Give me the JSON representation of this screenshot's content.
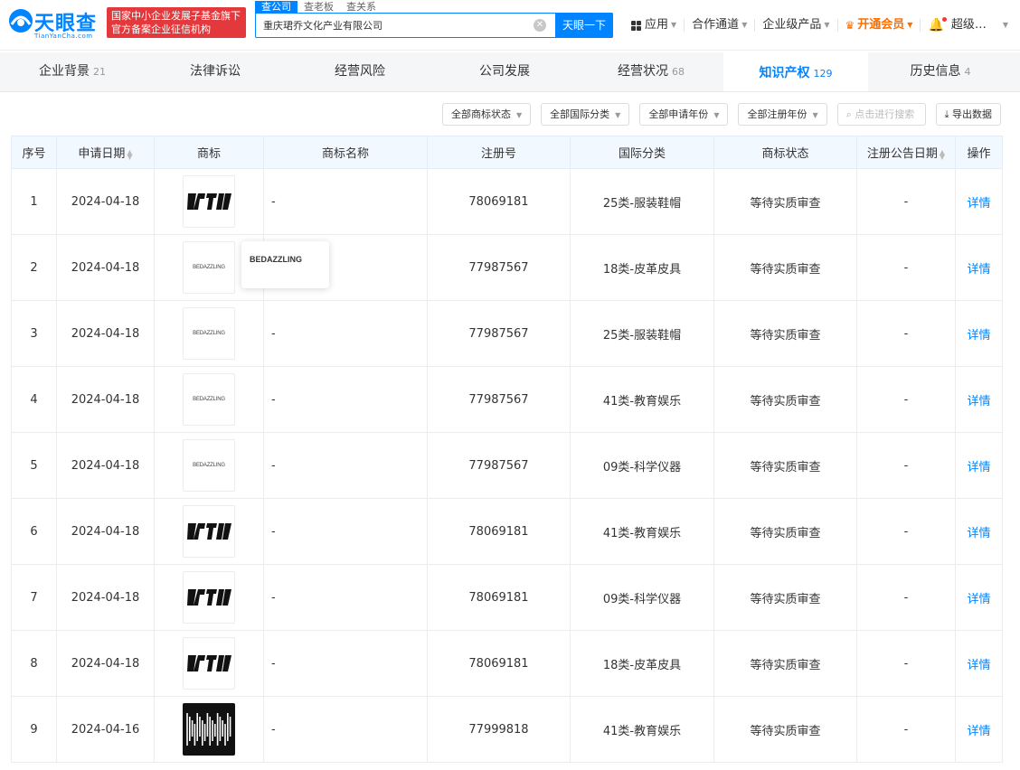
{
  "header": {
    "logo_cn": "天眼查",
    "logo_en": "TianYanCha.com",
    "badge_line1": "国家中小企业发展子基金旗下",
    "badge_line2": "官方备案企业征信机构",
    "search_tabs": [
      "查公司",
      "查老板",
      "查关系"
    ],
    "search_value": "重庆珺乔文化产业有限公司",
    "search_button": "天眼一下",
    "nav": {
      "app": "应用",
      "partner": "合作通道",
      "enterprise": "企业级产品",
      "vip": "开通会员",
      "user": "超级…"
    }
  },
  "tabs": [
    {
      "label": "企业背景",
      "count": "21"
    },
    {
      "label": "法律诉讼",
      "count": ""
    },
    {
      "label": "经营风险",
      "count": ""
    },
    {
      "label": "公司发展",
      "count": ""
    },
    {
      "label": "经营状况",
      "count": "68"
    },
    {
      "label": "知识产权",
      "count": "129"
    },
    {
      "label": "历史信息",
      "count": "4"
    }
  ],
  "filters": {
    "status": "全部商标状态",
    "intl_class": "全部国际分类",
    "apply_year": "全部申请年份",
    "reg_year": "全部注册年份",
    "search_placeholder": "点击进行搜索",
    "export": "导出数据"
  },
  "table": {
    "headers": [
      "序号",
      "申请日期",
      "商标",
      "商标名称",
      "注册号",
      "国际分类",
      "商标状态",
      "注册公告日期",
      "操作"
    ],
    "rows": [
      {
        "no": "1",
        "date": "2024-04-18",
        "name": "-",
        "reg": "78069181",
        "cls": "25类-服装鞋帽",
        "status": "等待实质审查",
        "pub": "-",
        "op": "详情"
      },
      {
        "no": "2",
        "date": "2024-04-18",
        "name": "",
        "reg": "77987567",
        "cls": "18类-皮革皮具",
        "status": "等待实质审查",
        "pub": "-",
        "op": "详情"
      },
      {
        "no": "3",
        "date": "2024-04-18",
        "name": "-",
        "reg": "77987567",
        "cls": "25类-服装鞋帽",
        "status": "等待实质审查",
        "pub": "-",
        "op": "详情"
      },
      {
        "no": "4",
        "date": "2024-04-18",
        "name": "-",
        "reg": "77987567",
        "cls": "41类-教育娱乐",
        "status": "等待实质审查",
        "pub": "-",
        "op": "详情"
      },
      {
        "no": "5",
        "date": "2024-04-18",
        "name": "-",
        "reg": "77987567",
        "cls": "09类-科学仪器",
        "status": "等待实质审查",
        "pub": "-",
        "op": "详情"
      },
      {
        "no": "6",
        "date": "2024-04-18",
        "name": "-",
        "reg": "78069181",
        "cls": "41类-教育娱乐",
        "status": "等待实质审查",
        "pub": "-",
        "op": "详情"
      },
      {
        "no": "7",
        "date": "2024-04-18",
        "name": "-",
        "reg": "78069181",
        "cls": "09类-科学仪器",
        "status": "等待实质审查",
        "pub": "-",
        "op": "详情"
      },
      {
        "no": "8",
        "date": "2024-04-18",
        "name": "-",
        "reg": "78069181",
        "cls": "18类-皮革皮具",
        "status": "等待实质审查",
        "pub": "-",
        "op": "详情"
      },
      {
        "no": "9",
        "date": "2024-04-16",
        "name": "-",
        "reg": "77999818",
        "cls": "41类-教育娱乐",
        "status": "等待实质审查",
        "pub": "-",
        "op": "详情"
      }
    ],
    "trademark_text": "BEDAZZLING"
  },
  "tooltip": {
    "text": "BEDAZZLING"
  },
  "colors": {
    "brand": "#0084ff",
    "badge_red": "#e4393c",
    "vip_orange": "#ff6f00"
  }
}
